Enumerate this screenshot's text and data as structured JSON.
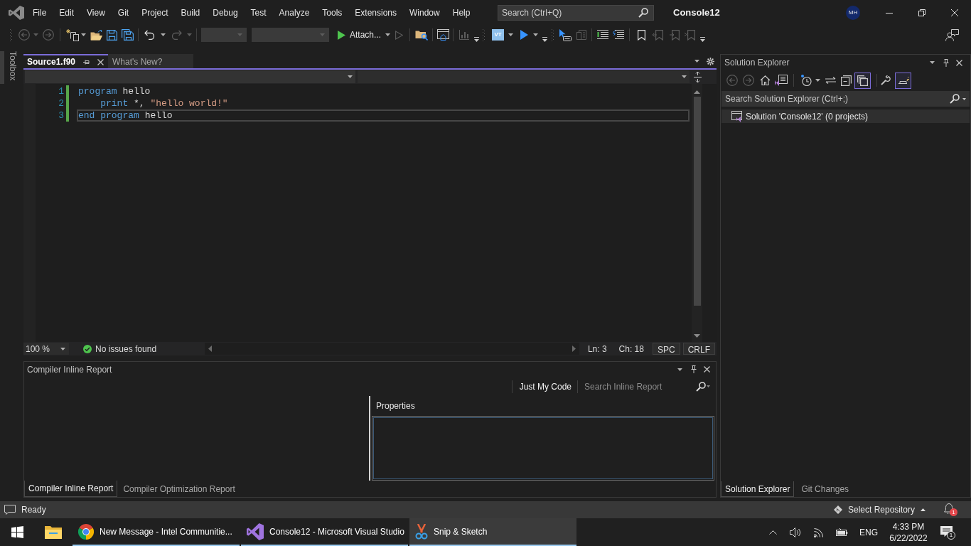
{
  "menu_bar": {
    "items": [
      "File",
      "Edit",
      "View",
      "Git",
      "Project",
      "Build",
      "Debug",
      "Test",
      "Analyze",
      "Tools",
      "Extensions",
      "Window",
      "Help"
    ],
    "search": {
      "placeholder": "Search (Ctrl+Q)"
    },
    "title": "Console12",
    "account": "MH"
  },
  "toolbar": {
    "attach_button": "Attach...",
    "vt_button": "VT"
  },
  "toolbox": {
    "label": "Toolbox"
  },
  "editor": {
    "tabs": [
      {
        "label": "Source1.f90",
        "selected": true
      },
      {
        "label": "What's New?",
        "selected": false
      }
    ],
    "lines": [
      {
        "number": "1",
        "changed": true,
        "current": false,
        "tokens": [
          {
            "kind": "keyword",
            "text": "program"
          },
          {
            "kind": "plain",
            "text": " hello"
          }
        ]
      },
      {
        "number": "2",
        "changed": true,
        "current": false,
        "tokens": [
          {
            "kind": "keyword",
            "text": "    print"
          },
          {
            "kind": "plain",
            "text": " *, "
          },
          {
            "kind": "string",
            "text": "\"hello world!\""
          }
        ]
      },
      {
        "number": "3",
        "changed": true,
        "current": true,
        "tokens": [
          {
            "kind": "keyword",
            "text": "end program"
          },
          {
            "kind": "plain",
            "text": " hello"
          }
        ]
      }
    ],
    "status": {
      "zoom": "100 %",
      "issues": "No issues found",
      "line": "Ln: 3",
      "column": "Ch: 18",
      "whitespace": "SPC",
      "line_ending": "CRLF"
    }
  },
  "compiler_report": {
    "title": "Compiler Inline Report",
    "filter_button": "Just My Code",
    "search": {
      "placeholder": "Search Inline Report"
    },
    "properties": {
      "title": "Properties"
    },
    "tabs": [
      {
        "label": "Compiler Inline Report",
        "selected": true
      },
      {
        "label": "Compiler Optimization Report",
        "selected": false
      }
    ]
  },
  "solution_explorer": {
    "title": "Solution Explorer",
    "toolbar_toggles": [
      {
        "on": true
      },
      {
        "on": true
      }
    ],
    "search": {
      "placeholder": "Search Solution Explorer (Ctrl+;)"
    },
    "tree": [
      {
        "label": "Solution 'Console12' (0 projects)",
        "selected": true
      }
    ],
    "tabs": [
      {
        "label": "Solution Explorer",
        "selected": true
      },
      {
        "label": "Git Changes",
        "selected": false
      }
    ]
  },
  "status_bar": {
    "text": "Ready",
    "repository": "Select Repository",
    "notifications": "1"
  },
  "taskbar": {
    "apps": [
      {
        "running": false,
        "selected": false
      },
      {
        "label": "New Message - Intel Communitie...",
        "running": true,
        "selected": false
      },
      {
        "label": "Console12 - Microsoft Visual Studio",
        "running": true,
        "selected": false
      },
      {
        "label": "Snip & Sketch",
        "running": true,
        "selected": true
      }
    ],
    "tray": {
      "language": "ENG",
      "time": "4:33 PM",
      "date": "6/22/2022",
      "notifications": "1"
    }
  }
}
